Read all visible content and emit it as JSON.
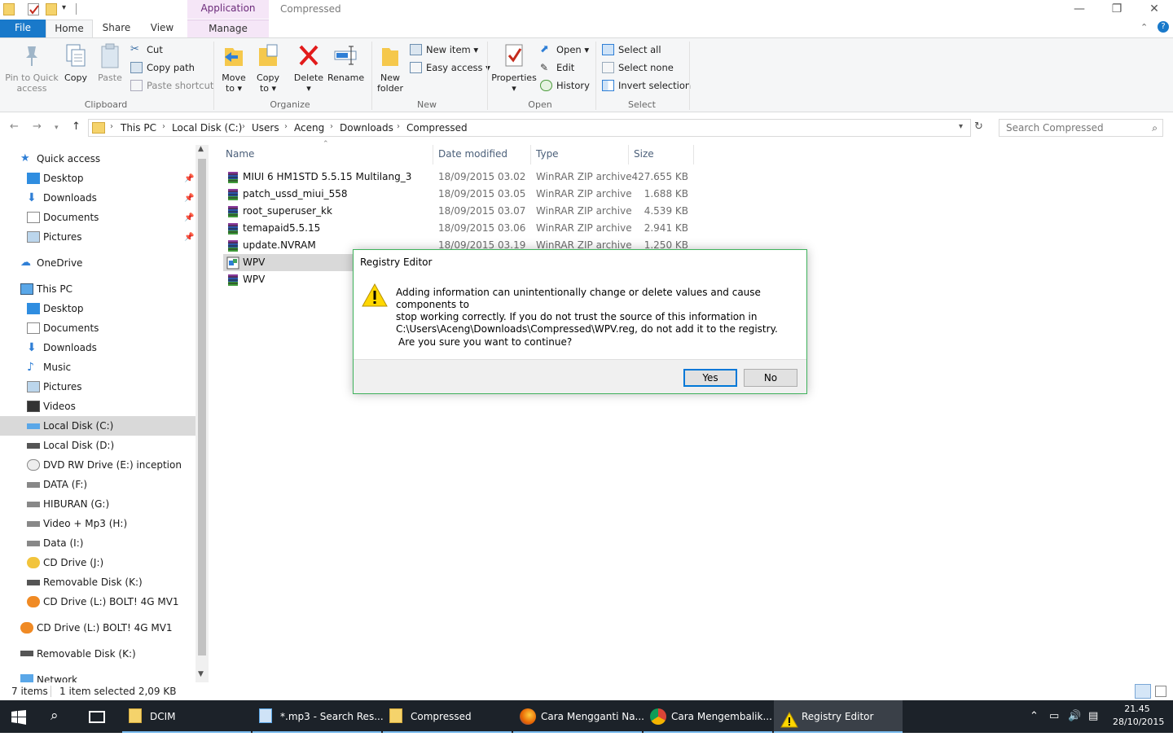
{
  "window": {
    "title": "Compressed",
    "contextual_tab": "Application Tools",
    "min": "—",
    "max": "❐",
    "close": "✕"
  },
  "tabs": {
    "file": "File",
    "home": "Home",
    "share": "Share",
    "view": "View",
    "manage": "Manage"
  },
  "ribbon": {
    "pin": [
      "Pin to Quick",
      "access"
    ],
    "copy": "Copy",
    "paste": "Paste",
    "cut": "Cut",
    "copy_path": "Copy path",
    "paste_shortcut": "Paste shortcut",
    "clipboard": "Clipboard",
    "move_to": [
      "Move",
      "to ▾"
    ],
    "copy_to": [
      "Copy",
      "to ▾"
    ],
    "delete": [
      "Delete",
      "▾"
    ],
    "rename": "Rename",
    "organize": "Organize",
    "new_folder": [
      "New",
      "folder"
    ],
    "new_item": "New item ▾",
    "easy_access": "Easy access ▾",
    "new": "New",
    "properties": [
      "Properties",
      "▾"
    ],
    "open_btn": "Open ▾",
    "edit": "Edit",
    "history": "History",
    "open": "Open",
    "select_all": "Select all",
    "select_none": "Select none",
    "invert_selection": "Invert selection",
    "select": "Select"
  },
  "address": {
    "crumbs": [
      "This PC",
      "Local Disk (C:)",
      "Users",
      "Aceng",
      "Downloads",
      "Compressed"
    ],
    "search_placeholder": "Search Compressed"
  },
  "nav": {
    "quick_access": "Quick access",
    "qa_items": [
      "Desktop",
      "Downloads",
      "Documents",
      "Pictures"
    ],
    "onedrive": "OneDrive",
    "this_pc": "This PC",
    "pc_items": [
      "Desktop",
      "Documents",
      "Downloads",
      "Music",
      "Pictures",
      "Videos",
      "Local Disk (C:)",
      "Local Disk (D:)",
      "DVD RW Drive (E:) inception",
      "DATA (F:)",
      "HIBURAN (G:)",
      "Video + Mp3 (H:)",
      "Data (I:)",
      "CD Drive (J:)",
      "Removable Disk (K:)",
      "CD Drive (L:) BOLT! 4G MV1"
    ],
    "extra": [
      "CD Drive (L:) BOLT! 4G MV1",
      "Removable Disk (K:)",
      "Network"
    ]
  },
  "columns": {
    "name": "Name",
    "date": "Date modified",
    "type": "Type",
    "size": "Size"
  },
  "files": [
    {
      "name": "MIUI 6 HM1STD 5.5.15 Multilang_3",
      "date": "18/09/2015 03.02",
      "type": "WinRAR ZIP archive",
      "size": "427.655 KB"
    },
    {
      "name": "patch_ussd_miui_558",
      "date": "18/09/2015 03.05",
      "type": "WinRAR ZIP archive",
      "size": "1.688 KB"
    },
    {
      "name": "root_superuser_kk",
      "date": "18/09/2015 03.07",
      "type": "WinRAR ZIP archive",
      "size": "4.539 KB"
    },
    {
      "name": "temapaid5.5.15",
      "date": "18/09/2015 03.06",
      "type": "WinRAR ZIP archive",
      "size": "2.941 KB"
    },
    {
      "name": "update.NVRAM",
      "date": "18/09/2015 03.19",
      "type": "WinRAR ZIP archive",
      "size": "1.250 KB"
    },
    {
      "name": "WPV",
      "date": "",
      "type": "",
      "size": ""
    },
    {
      "name": "WPV",
      "date": "",
      "type": "",
      "size": ""
    }
  ],
  "status": {
    "items": "7 items",
    "selected": "1 item selected  2,09 KB"
  },
  "dialog": {
    "title": "Registry Editor",
    "line1": "Adding information can unintentionally change or delete values and cause components to",
    "line2": "stop working correctly. If you do not trust the source of this information in",
    "line3": "C:\\Users\\Aceng\\Downloads\\Compressed\\WPV.reg, do not add it to the registry.",
    "question": "Are you sure you want to continue?",
    "yes": "Yes",
    "no": "No"
  },
  "taskbar": {
    "items": [
      "DCIM",
      "*.mp3 - Search Res...",
      "Compressed",
      "Cara Mengganti Na...",
      "Cara Mengembalik...",
      "Registry Editor"
    ],
    "time": "21.45",
    "date": "28/10/2015"
  },
  "colors": {
    "accent": "#1979ca",
    "dialog_border": "#3fb25c",
    "taskbar": "#1c2229"
  }
}
